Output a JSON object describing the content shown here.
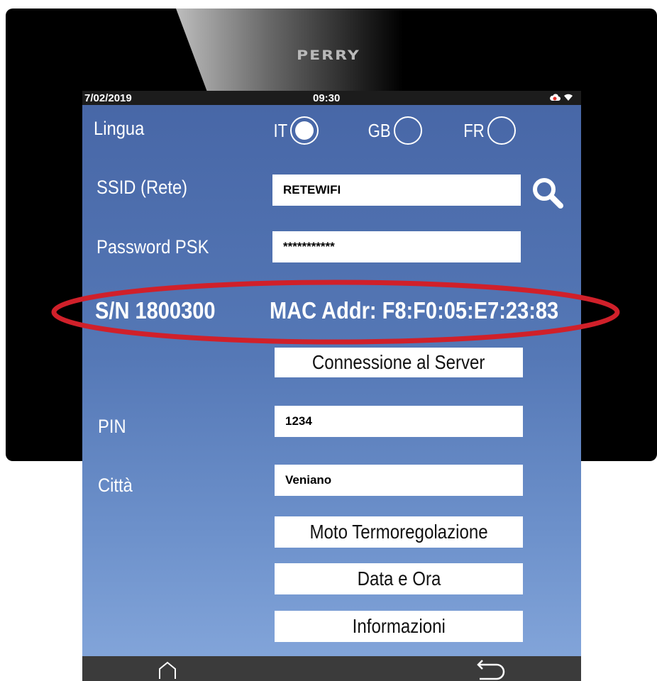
{
  "brand": "PERRY",
  "status_bar": {
    "date": "7/02/2019",
    "time": "09:30",
    "icons": [
      "cloud-icon",
      "wifi-icon"
    ]
  },
  "language": {
    "label": "Lingua",
    "options": [
      {
        "code": "IT",
        "selected": true
      },
      {
        "code": "GB",
        "selected": false
      },
      {
        "code": "FR",
        "selected": false
      }
    ]
  },
  "ssid": {
    "label": "SSID (Rete)",
    "value": "RETEWIFI"
  },
  "password": {
    "label": "Password PSK",
    "value": "***********"
  },
  "device_info": {
    "serial": "S/N 1800300",
    "mac": "MAC Addr: F8:F0:05:E7:23:83"
  },
  "buttons": {
    "server": "Connessione al Server",
    "thermo": "Moto Termoregolazione",
    "datetime": "Data e Ora",
    "info": "Informazioni"
  },
  "pin": {
    "label": "PIN",
    "value": "1234"
  },
  "city": {
    "label": "Città",
    "value": "Veniano"
  },
  "colors": {
    "screen_top": "#4766a6",
    "screen_bottom": "#86a8dc",
    "highlight": "#d0202a",
    "status_bar": "#1c1c1c",
    "nav_bar": "#3b3b3b"
  }
}
